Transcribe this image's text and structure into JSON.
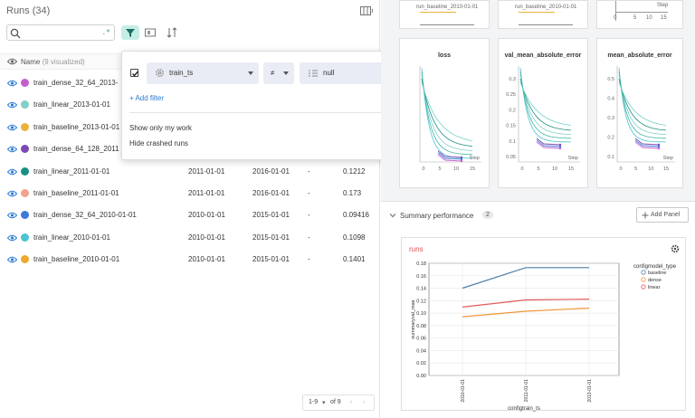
{
  "runs_panel": {
    "title": "Runs (34)",
    "search_regex": ".*",
    "name_header": "Name",
    "name_header_sub": "(9 visualized)",
    "rows": [
      {
        "name": "train_dense_32_64_2013-",
        "color": "#c45ecf",
        "c1": "",
        "c2": "",
        "c3": "",
        "c4": ""
      },
      {
        "name": "train_linear_2013-01-01",
        "color": "#80cfc8",
        "c1": "",
        "c2": "",
        "c3": "",
        "c4": ""
      },
      {
        "name": "train_baseline_2013-01-01",
        "color": "#e8b23a",
        "c1": "",
        "c2": "",
        "c3": "",
        "c4": ""
      },
      {
        "name": "train_dense_64_128_2011",
        "color": "#7b49b5",
        "c1": "",
        "c2": "",
        "c3": "",
        "c4": ""
      },
      {
        "name": "train_linear_2011-01-01",
        "color": "#1a8f84",
        "c1": "2011-01-01",
        "c2": "2016-01-01",
        "c3": "-",
        "c4": "0.1212"
      },
      {
        "name": "train_baseline_2011-01-01",
        "color": "#f2a38e",
        "c1": "2011-01-01",
        "c2": "2016-01-01",
        "c3": "-",
        "c4": "0.173"
      },
      {
        "name": "train_dense_32_64_2010-01-01",
        "color": "#3e7ad8",
        "c1": "2010-01-01",
        "c2": "2015-01-01",
        "c3": "-",
        "c4": "0.09416"
      },
      {
        "name": "train_linear_2010-01-01",
        "color": "#4cc3d3",
        "c1": "2010-01-01",
        "c2": "2015-01-01",
        "c3": "-",
        "c4": "0.1098"
      },
      {
        "name": "train_baseline_2010-01-01",
        "color": "#eaaa2c",
        "c1": "2010-01-01",
        "c2": "2015-01-01",
        "c3": "-",
        "c4": "0.1401"
      }
    ],
    "pager_range": "1-9",
    "pager_of": "of 9"
  },
  "filter_popup": {
    "field": "train_ts",
    "operator": "≠",
    "value": "null",
    "add_filter": "+ Add filter",
    "toggle1": "Show only my work",
    "toggle2": "Hide crashed runs"
  },
  "top_cards": {
    "legend_label": "run_baseline_2010-01-01",
    "card3_ticks": [
      "0",
      "5",
      "10",
      "15"
    ],
    "card3_step": "Step"
  },
  "mini_charts": [
    {
      "title": "loss",
      "yticks": [],
      "xticks": [
        "0",
        "5",
        "10",
        "15"
      ],
      "xlabel": "Step"
    },
    {
      "title": "val_mean_absolute_error",
      "yticks": [
        "0.3",
        "0.25",
        "0.2",
        "0.15",
        "0.1",
        "0.05"
      ],
      "xticks": [
        "0",
        "5",
        "10",
        "15"
      ],
      "xlabel": "Step"
    },
    {
      "title": "mean_absolute_error",
      "yticks": [
        "0.5",
        "0.4",
        "0.3",
        "0.2",
        "0.1"
      ],
      "xticks": [
        "0",
        "5",
        "10",
        "15"
      ],
      "xlabel": "Step"
    }
  ],
  "summary": {
    "title": "Summary performance",
    "count": "2",
    "add_panel": "Add Panel",
    "panel_label": "runs"
  },
  "chart_data": {
    "type": "line",
    "categories": [
      "2010-01-01",
      "2011-01-01",
      "2013-01-01"
    ],
    "series": [
      {
        "name": "baseline",
        "values": [
          0.1401,
          0.173,
          0.173
        ],
        "color": "#4e7fa8"
      },
      {
        "name": "dense",
        "values": [
          0.09416,
          0.103,
          0.108
        ],
        "color": "#f0953a"
      },
      {
        "name": "linear",
        "values": [
          0.1098,
          0.1212,
          0.1225
        ],
        "color": "#e35a5a"
      }
    ],
    "yticks": [
      "0.00",
      "0.02",
      "0.04",
      "0.06",
      "0.08",
      "0.10",
      "0.12",
      "0.14",
      "0.16",
      "0.18"
    ],
    "ylim": [
      0,
      0.18
    ],
    "xlabel": "configtrain_ts",
    "ylabel": "summaryval_mae",
    "legend_title": "configmodel_type",
    "legend_position": "right"
  }
}
